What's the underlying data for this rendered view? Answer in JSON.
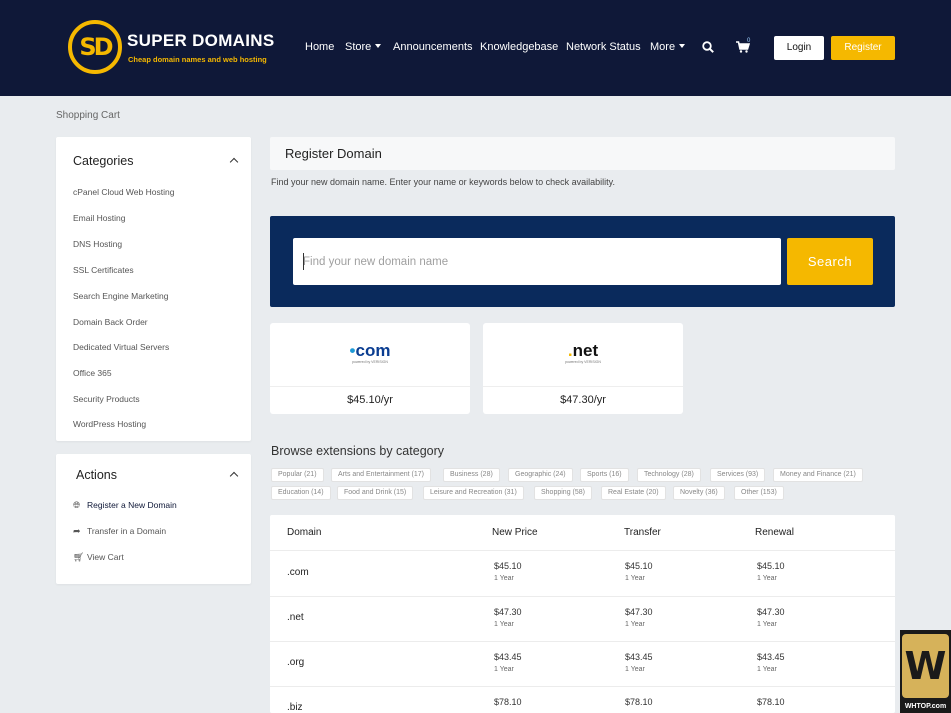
{
  "brand": {
    "logo_letters": "SD",
    "name": "SUPER DOMAINS",
    "tagline": "Cheap domain names and web hosting",
    "accent_color": "#f5b800",
    "header_color": "#0f1838"
  },
  "nav": {
    "items": [
      {
        "label": "Home"
      },
      {
        "label": "Store"
      },
      {
        "label": "Announcements"
      },
      {
        "label": "Knowledgebase"
      },
      {
        "label": "Network Status"
      },
      {
        "label": "More"
      }
    ],
    "cart_count": "0",
    "login_label": "Login",
    "register_label": "Register"
  },
  "breadcrumb": "Shopping Cart",
  "sidebar": {
    "categories_title": "Categories",
    "categories": [
      "cPanel Cloud Web Hosting",
      "Email Hosting",
      "DNS Hosting",
      "SSL Certificates",
      "Search Engine Marketing",
      "Domain Back Order",
      "Dedicated Virtual Servers",
      "Office 365",
      "Security Products",
      "WordPress Hosting"
    ],
    "actions_title": "Actions",
    "actions": [
      {
        "label": "Register a New Domain",
        "icon": "globe-icon"
      },
      {
        "label": "Transfer in a Domain",
        "icon": "share-icon"
      },
      {
        "label": "View Cart",
        "icon": "cart-icon"
      }
    ]
  },
  "main": {
    "title": "Register Domain",
    "intro": "Find your new domain name. Enter your name or keywords below to check availability.",
    "search": {
      "placeholder": "Find your new domain name",
      "button_label": "Search"
    },
    "featured": [
      {
        "tld": "com",
        "logo_sub": "powered by VERISIGN",
        "price": "$45.10/yr"
      },
      {
        "tld": "net",
        "logo_sub": "powered by VERISIGN",
        "price": "$47.30/yr"
      }
    ],
    "browse_title": "Browse extensions by category",
    "categories": [
      "Popular (21)",
      "Arts and Entertainment (17)",
      "Business (28)",
      "Geographic (24)",
      "Sports (16)",
      "Technology (28)",
      "Services (93)",
      "Money and Finance (21)",
      "Education (14)",
      "Food and Drink (15)",
      "Leisure and Recreation (31)",
      "Shopping (58)",
      "Real Estate (20)",
      "Novelty (36)",
      "Other (153)"
    ],
    "table": {
      "headers": [
        "Domain",
        "New Price",
        "Transfer",
        "Renewal"
      ],
      "rows": [
        {
          "domain": ".com",
          "new_price": "$45.10",
          "new_term": "1 Year",
          "transfer": "$45.10",
          "transfer_term": "1 Year",
          "renewal": "$45.10",
          "renewal_term": "1 Year"
        },
        {
          "domain": ".net",
          "new_price": "$47.30",
          "new_term": "1 Year",
          "transfer": "$47.30",
          "transfer_term": "1 Year",
          "renewal": "$47.30",
          "renewal_term": "1 Year"
        },
        {
          "domain": ".org",
          "new_price": "$43.45",
          "new_term": "1 Year",
          "transfer": "$43.45",
          "transfer_term": "1 Year",
          "renewal": "$43.45",
          "renewal_term": "1 Year"
        },
        {
          "domain": ".biz",
          "new_price": "$78.10",
          "new_term": "",
          "transfer": "$78.10",
          "transfer_term": "",
          "renewal": "$78.10",
          "renewal_term": ""
        }
      ]
    }
  },
  "watermark": {
    "mark": "W",
    "text": "WHTOP.com"
  }
}
